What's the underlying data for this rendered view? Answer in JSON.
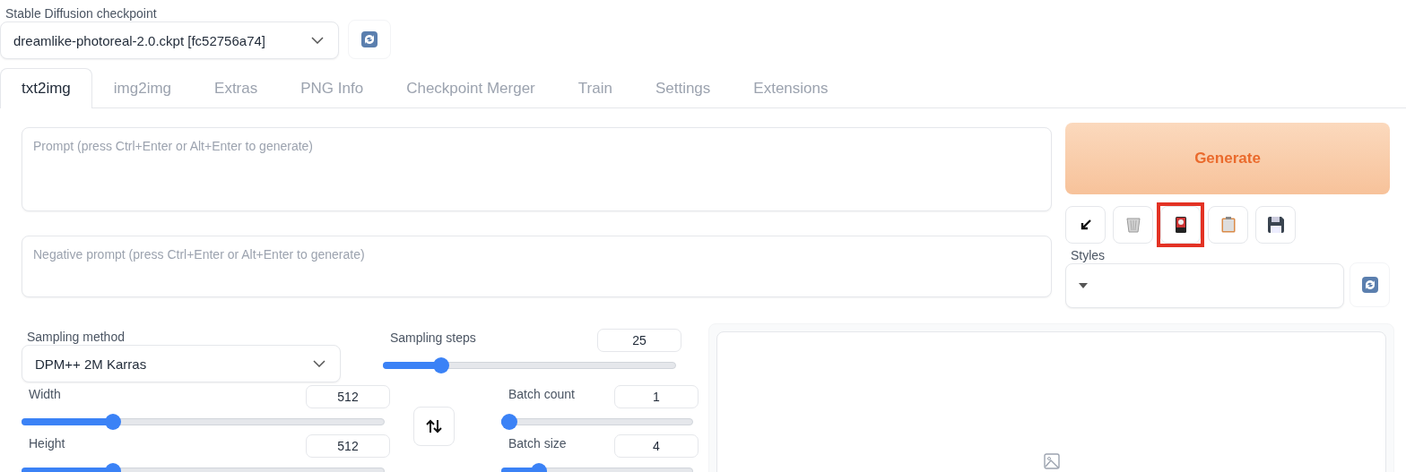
{
  "checkpoint": {
    "label": "Stable Diffusion checkpoint",
    "value": "dreamlike-photoreal-2.0.ckpt [fc52756a74]"
  },
  "tabs": [
    {
      "label": "txt2img",
      "selected": true
    },
    {
      "label": "img2img",
      "selected": false
    },
    {
      "label": "Extras",
      "selected": false
    },
    {
      "label": "PNG Info",
      "selected": false
    },
    {
      "label": "Checkpoint Merger",
      "selected": false
    },
    {
      "label": "Train",
      "selected": false
    },
    {
      "label": "Settings",
      "selected": false
    },
    {
      "label": "Extensions",
      "selected": false
    }
  ],
  "prompt": {
    "placeholder": "Prompt (press Ctrl+Enter or Alt+Enter to generate)"
  },
  "negative_prompt": {
    "placeholder": "Negative prompt (press Ctrl+Enter or Alt+Enter to generate)"
  },
  "generate_button": "Generate",
  "tool_buttons": [
    {
      "kind": "arrow",
      "highlighted": false
    },
    {
      "kind": "trash",
      "highlighted": false
    },
    {
      "kind": "card",
      "highlighted": true
    },
    {
      "kind": "clipboard",
      "highlighted": false
    },
    {
      "kind": "floppy",
      "highlighted": false
    }
  ],
  "styles": {
    "label": "Styles"
  },
  "sampling_method": {
    "label": "Sampling method",
    "value": "DPM++ 2M Karras"
  },
  "sliders": [
    {
      "label": "Sampling steps",
      "value": "25",
      "level": 0.18
    },
    {
      "label": "Width",
      "value": "512",
      "level": 0.24
    },
    {
      "label": "Batch count",
      "value": "1",
      "level": 0
    },
    {
      "label": "Height",
      "value": "512",
      "level": 0.24
    },
    {
      "label": "Batch size",
      "value": "4",
      "level": 0.17
    }
  ]
}
